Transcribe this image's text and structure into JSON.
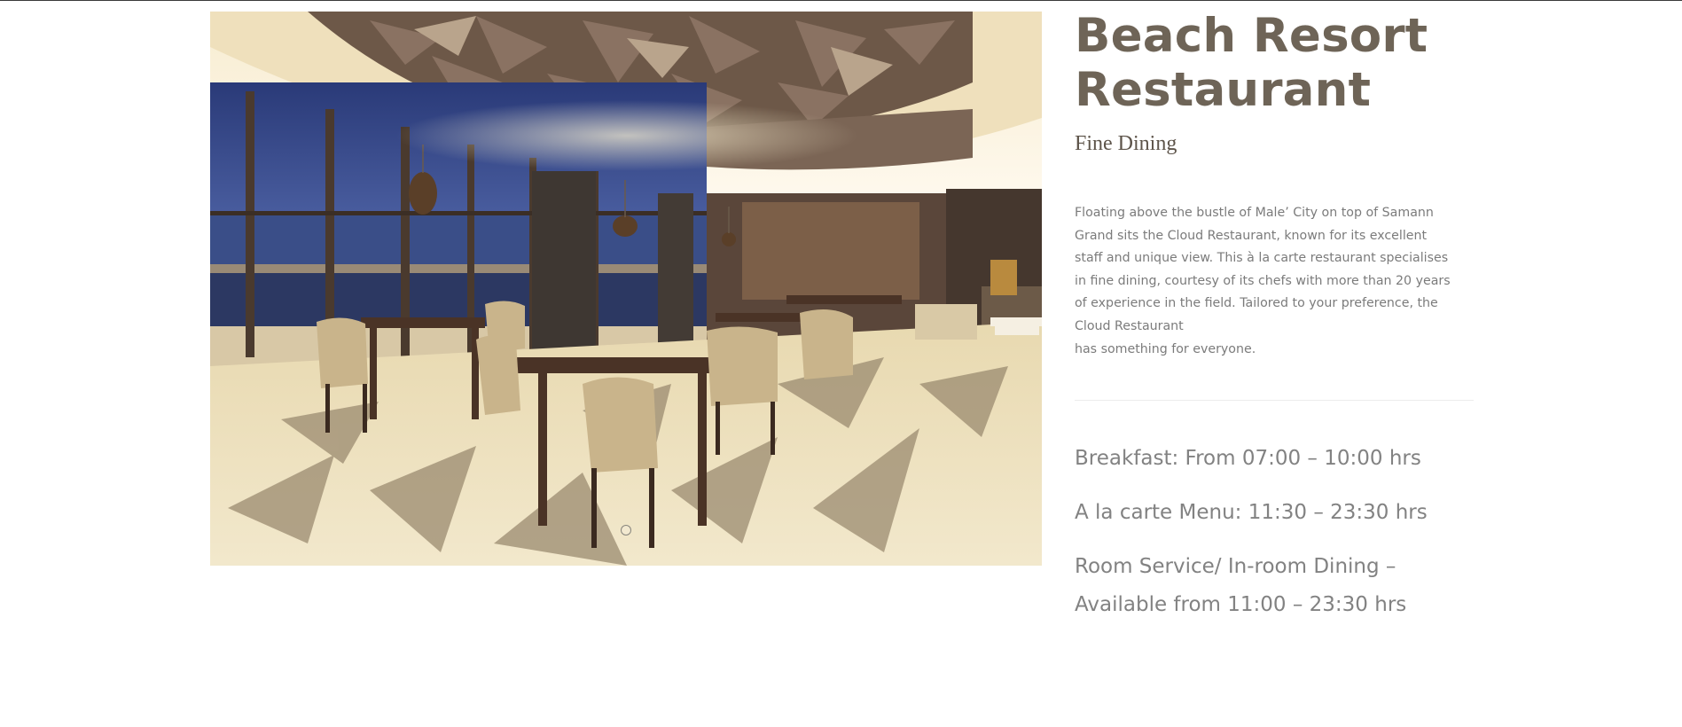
{
  "restaurant": {
    "title_line1": "Beach Resort",
    "title_line2": "Restaurant",
    "subtitle": "Fine Dining",
    "description": [
      "Floating above the bustle of Male’ City on top of Samann",
      "Grand sits the Cloud Restaurant, known for its excellent",
      "staff and unique view. This  à la carte restaurant specialises",
      "in fine dining, courtesy of its chefs with more than 20 years",
      "of experience in the field. Tailored to your preference, the",
      "Cloud Restaurant",
      "has something for everyone."
    ],
    "hours": {
      "breakfast": "Breakfast: From 07:00 – 10:00 hrs",
      "a_la_carte": "A la carte Menu:  11:30 – 23:30 hrs",
      "room_service_line1": "Room Service/ In-room Dining –",
      "room_service_line2": "Available from 11:00 – 23:30 hrs"
    }
  },
  "slider": {
    "image_description_icon": "restaurant-interior-photo",
    "dots": 1
  },
  "colors": {
    "title": "#6e6457",
    "body_text": "#7b7b7b",
    "hours_text": "#828282"
  }
}
